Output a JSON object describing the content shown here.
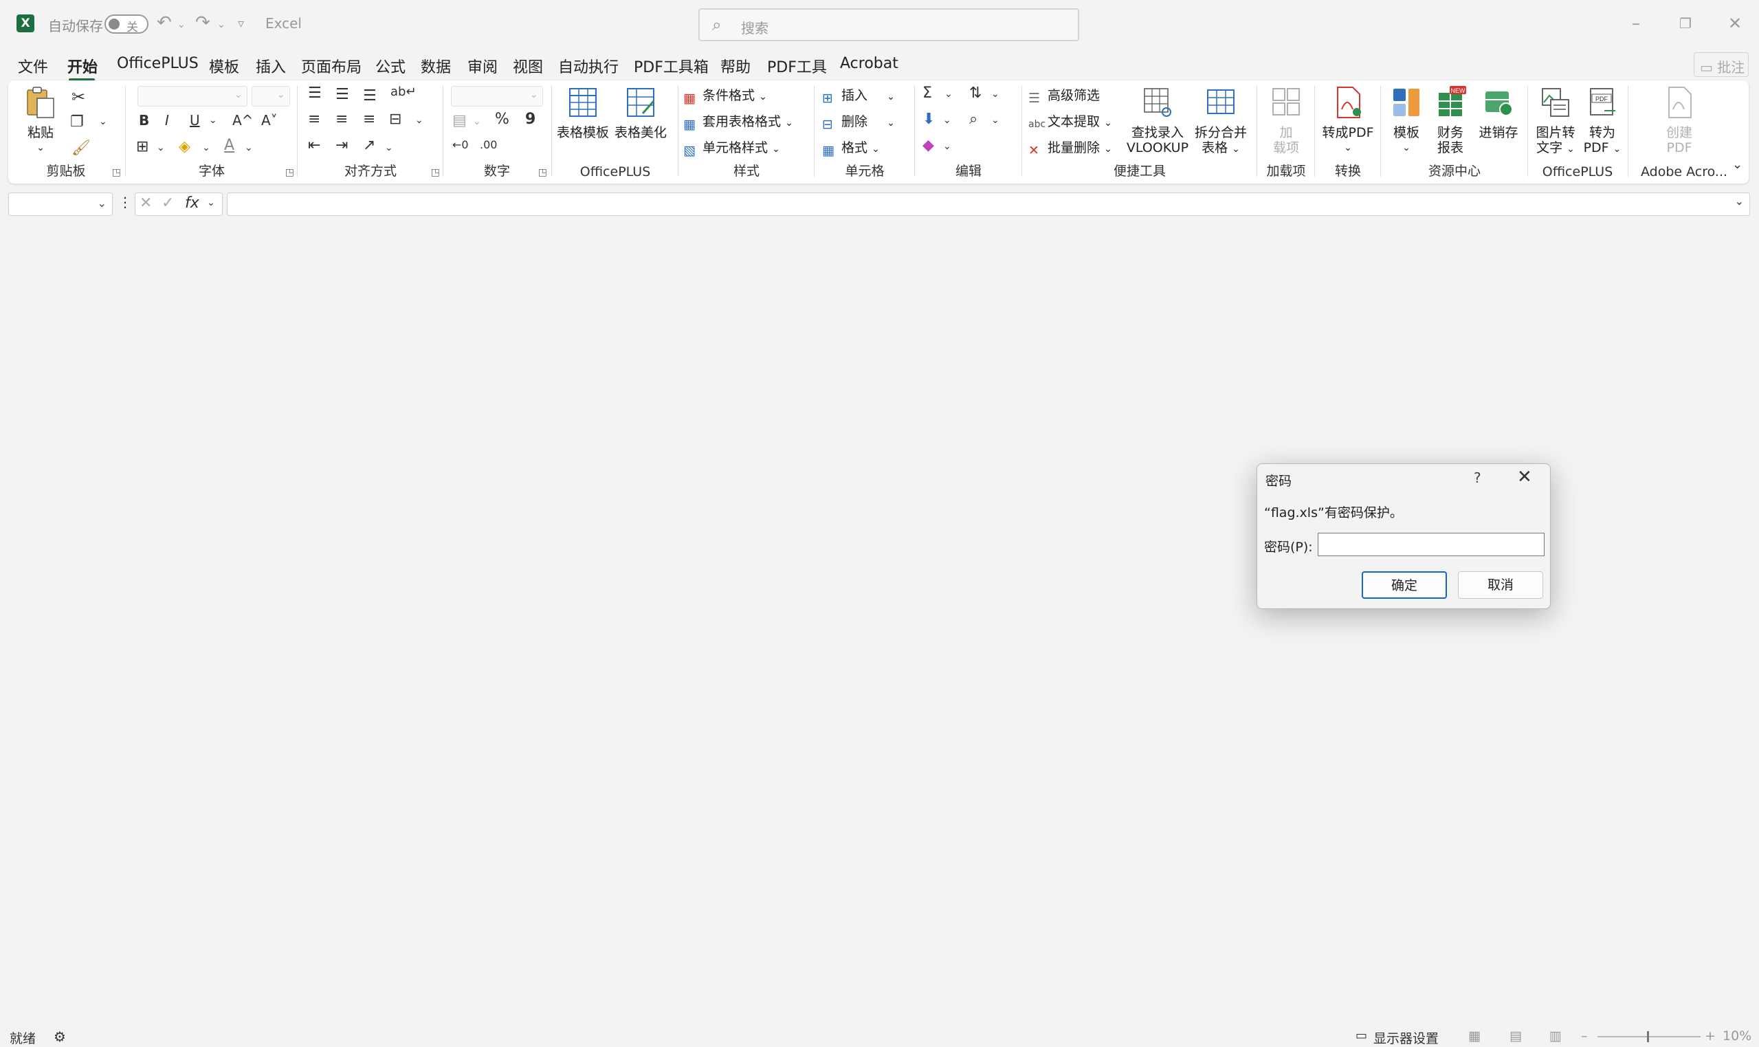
{
  "titlebar": {
    "autosave_label": "自动保存",
    "autosave_state": "关",
    "app_name": "Excel",
    "search_placeholder": "搜索",
    "icons": [
      "excel-logo",
      "undo-icon",
      "redo-icon",
      "customize-icon",
      "minimize-icon",
      "restore-icon",
      "close-icon"
    ]
  },
  "menu": {
    "tabs": [
      "文件",
      "开始",
      "OfficePLUS",
      "模板",
      "插入",
      "页面布局",
      "公式",
      "数据",
      "审阅",
      "视图",
      "自动执行",
      "PDF工具箱",
      "帮助",
      "PDF工具",
      "Acrobat"
    ],
    "active_tab": "开始",
    "comment_label": "批注"
  },
  "ribbon": {
    "clipboard": {
      "paste": "粘贴",
      "group": "剪贴板"
    },
    "font": {
      "group": "字体",
      "bold": "B",
      "italic": "I",
      "underline": "U",
      "grow": "A^",
      "shrink": "A˅"
    },
    "alignment": {
      "group": "对齐方式"
    },
    "number": {
      "group": "数字",
      "percent": "%",
      "comma": "9"
    },
    "officeplus1": {
      "table_template": "表格模板",
      "table_beautify": "表格美化",
      "group": "OfficePLUS"
    },
    "styles": {
      "conditional": "条件格式",
      "table_format": "套用表格格式",
      "cell_style": "单元格样式",
      "group": "样式"
    },
    "cells": {
      "insert": "插入",
      "delete": "删除",
      "format": "格式",
      "group": "单元格"
    },
    "editing": {
      "group": "编辑"
    },
    "tools": {
      "advanced_filter": "高级筛选",
      "text_extract": "文本提取",
      "batch_delete": "批量删除",
      "vlookup_line1": "查找录入",
      "vlookup_line2": "VLOOKUP",
      "split_line1": "拆分合并",
      "split_line2": "表格",
      "group": "便捷工具"
    },
    "addins": {
      "line1": "加",
      "line2": "载项",
      "group": "加载项"
    },
    "convert": {
      "to_pdf": "转成PDF",
      "group": "转换"
    },
    "resources": {
      "template": "模板",
      "report_line1": "财务",
      "report_line2": "报表",
      "inventory": "进销存",
      "new_badge": "NEW",
      "group": "资源中心"
    },
    "officeplus2": {
      "img_line1": "图片转",
      "img_line2": "文字",
      "pdf_line1": "转为",
      "pdf_line2": "PDF",
      "group": "OfficePLUS"
    },
    "acrobat": {
      "line1": "创建",
      "line2": "PDF",
      "group": "Adobe Acro..."
    }
  },
  "formula_bar": {
    "fx": "fx"
  },
  "status": {
    "ready": "就绪",
    "display_settings": "显示器设置",
    "zoom": "10%"
  },
  "dialog": {
    "title": "密码",
    "help": "?",
    "message": "“flag.xls”有密码保护。",
    "password_label": "密码(P):",
    "password_value": "",
    "ok": "确定",
    "cancel": "取消"
  },
  "colors": {
    "excel_green": "#1d6f42",
    "focus_blue": "#1a64c8",
    "pdf_red": "#d9342b"
  }
}
